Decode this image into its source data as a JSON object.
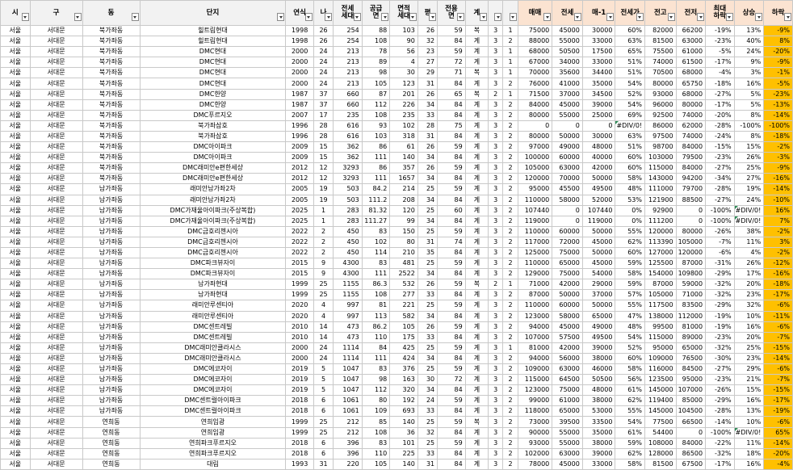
{
  "headers": [
    "시",
    "구",
    "동",
    "단지",
    "연식",
    "나",
    "전세\n세대",
    "공급\n면",
    "면적\n세대",
    "평",
    "전용\n면",
    "계",
    "",
    "",
    "매매",
    "전세",
    "매-1",
    "전세가",
    "전고",
    "전저",
    "최대\n하락",
    "상승",
    "하락"
  ],
  "rows": [
    [
      "서울",
      "서대문",
      "북가좌동",
      "힐트림현대",
      "1998",
      "26",
      "254",
      "88",
      "103",
      "26",
      "59",
      "복",
      "3",
      "1",
      "75000",
      "45000",
      "30000",
      "60%",
      "82000",
      "66200",
      "-19%",
      "13%",
      "-9%"
    ],
    [
      "서울",
      "서대문",
      "북가좌동",
      "힐트림현대",
      "1998",
      "26",
      "254",
      "108",
      "90",
      "32",
      "84",
      "계",
      "3",
      "2",
      "88000",
      "55000",
      "33000",
      "63%",
      "81500",
      "63000",
      "-23%",
      "40%",
      "8%"
    ],
    [
      "서울",
      "서대문",
      "북가좌동",
      "DMC현대",
      "2000",
      "24",
      "213",
      "78",
      "56",
      "23",
      "59",
      "계",
      "3",
      "1",
      "68000",
      "50500",
      "17500",
      "65%",
      "75500",
      "61000",
      "-5%",
      "24%",
      "-20%"
    ],
    [
      "서울",
      "서대문",
      "북가좌동",
      "DMC현대",
      "2000",
      "24",
      "213",
      "89",
      "4",
      "27",
      "72",
      "계",
      "3",
      "1",
      "67000",
      "34000",
      "33000",
      "51%",
      "74000",
      "61500",
      "-17%",
      "9%",
      "-9%"
    ],
    [
      "서울",
      "서대문",
      "북가좌동",
      "DMC현대",
      "2000",
      "24",
      "213",
      "98",
      "30",
      "29",
      "71",
      "복",
      "3",
      "1",
      "70000",
      "35600",
      "34400",
      "51%",
      "70500",
      "68000",
      "-4%",
      "3%",
      "-1%"
    ],
    [
      "서울",
      "서대문",
      "북가좌동",
      "DMC현대",
      "2000",
      "24",
      "213",
      "105",
      "123",
      "31",
      "84",
      "계",
      "3",
      "2",
      "76000",
      "41000",
      "35000",
      "54%",
      "80000",
      "65750",
      "-18%",
      "16%",
      "-5%"
    ],
    [
      "서울",
      "서대문",
      "북가좌동",
      "DMC한양",
      "1987",
      "37",
      "660",
      "87",
      "201",
      "26",
      "65",
      "복",
      "2",
      "1",
      "71500",
      "37000",
      "34500",
      "52%",
      "93000",
      "68000",
      "-27%",
      "5%",
      "-23%"
    ],
    [
      "서울",
      "서대문",
      "북가좌동",
      "DMC한양",
      "1987",
      "37",
      "660",
      "112",
      "226",
      "34",
      "84",
      "계",
      "3",
      "2",
      "84000",
      "45000",
      "39000",
      "54%",
      "96000",
      "80000",
      "-17%",
      "5%",
      "-13%"
    ],
    [
      "서울",
      "서대문",
      "북가좌동",
      "DMC푸르지오",
      "2007",
      "17",
      "235",
      "108",
      "235",
      "33",
      "84",
      "계",
      "3",
      "2",
      "80000",
      "55000",
      "25000",
      "69%",
      "92500",
      "74000",
      "-20%",
      "8%",
      "-14%"
    ],
    [
      "서울",
      "서대문",
      "북가좌동",
      "북가좌삼호",
      "1996",
      "28",
      "616",
      "93",
      "102",
      "28",
      "75",
      "계",
      "3",
      "2",
      "0",
      "0",
      "0",
      "#DIV/0!",
      "86000",
      "62000",
      "-28%",
      "-100%",
      "-100%"
    ],
    [
      "서울",
      "서대문",
      "북가좌동",
      "북가좌삼호",
      "1996",
      "28",
      "616",
      "103",
      "318",
      "31",
      "84",
      "계",
      "3",
      "2",
      "80000",
      "50000",
      "30000",
      "63%",
      "97500",
      "74000",
      "-24%",
      "8%",
      "-18%"
    ],
    [
      "서울",
      "서대문",
      "북가좌동",
      "DMC아이파크",
      "2009",
      "15",
      "362",
      "86",
      "61",
      "26",
      "59",
      "계",
      "3",
      "2",
      "97000",
      "49000",
      "48000",
      "51%",
      "98700",
      "84000",
      "-15%",
      "15%",
      "-2%"
    ],
    [
      "서울",
      "서대문",
      "북가좌동",
      "DMC아이파크",
      "2009",
      "15",
      "362",
      "111",
      "140",
      "34",
      "84",
      "계",
      "3",
      "2",
      "100000",
      "60000",
      "40000",
      "60%",
      "103000",
      "79500",
      "-23%",
      "26%",
      "-3%"
    ],
    [
      "서울",
      "서대문",
      "북가좌동",
      "DMC래미안e편한세상",
      "2012",
      "12",
      "3293",
      "86",
      "357",
      "26",
      "59",
      "계",
      "3",
      "2",
      "105000",
      "63000",
      "42000",
      "60%",
      "115000",
      "84000",
      "-27%",
      "25%",
      "-9%"
    ],
    [
      "서울",
      "서대문",
      "북가좌동",
      "DMC래미안e편한세상",
      "2012",
      "12",
      "3293",
      "111",
      "1657",
      "34",
      "84",
      "계",
      "3",
      "2",
      "120000",
      "70000",
      "50000",
      "58%",
      "143000",
      "94200",
      "-34%",
      "27%",
      "-16%"
    ],
    [
      "서울",
      "서대문",
      "남가좌동",
      "래미안남가좌2차",
      "2005",
      "19",
      "503",
      "84.2",
      "214",
      "25",
      "59",
      "계",
      "3",
      "2",
      "95000",
      "45500",
      "49500",
      "48%",
      "111000",
      "79700",
      "-28%",
      "19%",
      "-14%"
    ],
    [
      "서울",
      "서대문",
      "남가좌동",
      "래미안남가좌2차",
      "2005",
      "19",
      "503",
      "111.2",
      "208",
      "34",
      "84",
      "계",
      "3",
      "2",
      "110000",
      "58000",
      "52000",
      "53%",
      "121900",
      "88500",
      "-27%",
      "24%",
      "-10%"
    ],
    [
      "서울",
      "서대문",
      "남가좌동",
      "DMC가재울아이파크(주상복합)",
      "2025",
      "1",
      "283",
      "81.32",
      "120",
      "25",
      "60",
      "계",
      "3",
      "2",
      "107440",
      "0",
      "107440",
      "0%",
      "92900",
      "0",
      "-100%",
      "#DIV/0!",
      "16%"
    ],
    [
      "서울",
      "서대문",
      "남가좌동",
      "DMC가재울아이파크(주상복합)",
      "2025",
      "1",
      "283",
      "111.27",
      "99",
      "34",
      "84",
      "계",
      "3",
      "2",
      "119000",
      "0",
      "119000",
      "0%",
      "111200",
      "0",
      "-100%",
      "#DIV/0!",
      "7%"
    ],
    [
      "서울",
      "서대문",
      "남가좌동",
      "DMC금호리첸시아",
      "2022",
      "2",
      "450",
      "83",
      "150",
      "25",
      "59",
      "계",
      "3",
      "2",
      "110000",
      "60000",
      "50000",
      "55%",
      "120000",
      "80000",
      "-26%",
      "38%",
      "-2%"
    ],
    [
      "서울",
      "서대문",
      "남가좌동",
      "DMC금호리첸시아",
      "2022",
      "2",
      "450",
      "102",
      "80",
      "31",
      "74",
      "계",
      "3",
      "2",
      "117000",
      "72000",
      "45000",
      "62%",
      "113390",
      "105000",
      "-7%",
      "11%",
      "3%"
    ],
    [
      "서울",
      "서대문",
      "남가좌동",
      "DMC금호리첸시아",
      "2022",
      "2",
      "450",
      "114",
      "210",
      "35",
      "84",
      "계",
      "3",
      "2",
      "125000",
      "75000",
      "50000",
      "60%",
      "127000",
      "120000",
      "-6%",
      "4%",
      "-2%"
    ],
    [
      "서울",
      "서대문",
      "남가좌동",
      "DMC파크뷰자이",
      "2015",
      "9",
      "4300",
      "83",
      "481",
      "25",
      "59",
      "계",
      "3",
      "2",
      "110000",
      "65000",
      "45000",
      "59%",
      "125500",
      "87000",
      "-31%",
      "26%",
      "-12%"
    ],
    [
      "서울",
      "서대문",
      "남가좌동",
      "DMC파크뷰자이",
      "2015",
      "9",
      "4300",
      "111",
      "2522",
      "34",
      "84",
      "계",
      "3",
      "2",
      "129000",
      "75000",
      "54000",
      "58%",
      "154000",
      "109800",
      "-29%",
      "17%",
      "-16%"
    ],
    [
      "서울",
      "서대문",
      "남가좌동",
      "남가좌현대",
      "1999",
      "25",
      "1155",
      "86.3",
      "532",
      "26",
      "59",
      "복",
      "2",
      "1",
      "71000",
      "42000",
      "29000",
      "59%",
      "87000",
      "59000",
      "-32%",
      "20%",
      "-18%"
    ],
    [
      "서울",
      "서대문",
      "남가좌동",
      "남가좌현대",
      "1999",
      "25",
      "1155",
      "108",
      "277",
      "33",
      "84",
      "계",
      "3",
      "2",
      "87000",
      "50000",
      "37000",
      "57%",
      "105000",
      "71000",
      "-32%",
      "23%",
      "-17%"
    ],
    [
      "서울",
      "서대문",
      "남가좌동",
      "래미안루센티아",
      "2020",
      "4",
      "997",
      "81",
      "221",
      "25",
      "59",
      "계",
      "3",
      "2",
      "110000",
      "60000",
      "50000",
      "55%",
      "117500",
      "83500",
      "-29%",
      "32%",
      "-6%"
    ],
    [
      "서울",
      "서대문",
      "남가좌동",
      "래미안루센티아",
      "2020",
      "4",
      "997",
      "113",
      "582",
      "34",
      "84",
      "계",
      "3",
      "2",
      "123000",
      "58000",
      "65000",
      "47%",
      "138000",
      "112000",
      "-19%",
      "10%",
      "-11%"
    ],
    [
      "서울",
      "서대문",
      "남가좌동",
      "DMC센트레빌",
      "2010",
      "14",
      "473",
      "86.2",
      "105",
      "26",
      "59",
      "계",
      "3",
      "2",
      "94000",
      "45000",
      "49000",
      "48%",
      "99500",
      "81000",
      "-19%",
      "16%",
      "-6%"
    ],
    [
      "서울",
      "서대문",
      "남가좌동",
      "DMC센트레빌",
      "2010",
      "14",
      "473",
      "110",
      "175",
      "33",
      "84",
      "계",
      "3",
      "2",
      "107000",
      "57500",
      "49500",
      "54%",
      "115000",
      "89000",
      "-23%",
      "20%",
      "-7%"
    ],
    [
      "서울",
      "서대문",
      "남가좌동",
      "DMC래미안클라시스",
      "2000",
      "24",
      "1114",
      "84",
      "425",
      "25",
      "59",
      "계",
      "3",
      "1",
      "81000",
      "42000",
      "39000",
      "52%",
      "95000",
      "65000",
      "-32%",
      "25%",
      "-15%"
    ],
    [
      "서울",
      "서대문",
      "남가좌동",
      "DMC래미안클라시스",
      "2000",
      "24",
      "1114",
      "111",
      "424",
      "34",
      "84",
      "계",
      "3",
      "2",
      "94000",
      "56000",
      "38000",
      "60%",
      "109000",
      "76500",
      "-30%",
      "23%",
      "-14%"
    ],
    [
      "서울",
      "서대문",
      "남가좌동",
      "DMC에코자이",
      "2019",
      "5",
      "1047",
      "83",
      "376",
      "25",
      "59",
      "계",
      "3",
      "2",
      "109000",
      "63000",
      "46000",
      "58%",
      "116000",
      "84500",
      "-27%",
      "29%",
      "-6%"
    ],
    [
      "서울",
      "서대문",
      "남가좌동",
      "DMC에코자이",
      "2019",
      "5",
      "1047",
      "98",
      "163",
      "30",
      "72",
      "계",
      "3",
      "2",
      "115000",
      "64500",
      "50500",
      "56%",
      "123500",
      "95000",
      "-23%",
      "21%",
      "-7%"
    ],
    [
      "서울",
      "서대문",
      "남가좌동",
      "DMC에코자이",
      "2019",
      "5",
      "1047",
      "112",
      "320",
      "34",
      "84",
      "계",
      "3",
      "2",
      "123000",
      "75000",
      "48000",
      "61%",
      "145000",
      "107000",
      "-26%",
      "15%",
      "-15%"
    ],
    [
      "서울",
      "서대문",
      "남가좌동",
      "DMC센트럴아이파크",
      "2018",
      "6",
      "1061",
      "80",
      "192",
      "24",
      "59",
      "계",
      "3",
      "2",
      "99000",
      "61000",
      "38000",
      "62%",
      "119400",
      "85000",
      "-29%",
      "16%",
      "-17%"
    ],
    [
      "서울",
      "서대문",
      "남가좌동",
      "DMC센트럴아이파크",
      "2018",
      "6",
      "1061",
      "109",
      "693",
      "33",
      "84",
      "계",
      "3",
      "2",
      "118000",
      "65000",
      "53000",
      "55%",
      "145000",
      "104500",
      "-28%",
      "13%",
      "-19%"
    ],
    [
      "서울",
      "서대문",
      "연희동",
      "연희임광",
      "1999",
      "25",
      "212",
      "85",
      "140",
      "25",
      "59",
      "복",
      "3",
      "2",
      "73000",
      "39500",
      "33500",
      "54%",
      "77500",
      "66500",
      "-14%",
      "10%",
      "-6%"
    ],
    [
      "서울",
      "서대문",
      "연희동",
      "연희임광",
      "1999",
      "25",
      "212",
      "108",
      "36",
      "32",
      "84",
      "계",
      "3",
      "2",
      "90000",
      "55000",
      "35000",
      "61%",
      "54400",
      "0",
      "-100%",
      "#DIV/0!",
      "65%"
    ],
    [
      "서울",
      "서대문",
      "연희동",
      "연희파크푸르지오",
      "2018",
      "6",
      "396",
      "83",
      "101",
      "25",
      "59",
      "계",
      "3",
      "2",
      "93000",
      "55000",
      "38000",
      "59%",
      "108000",
      "84000",
      "-22%",
      "11%",
      "-14%"
    ],
    [
      "서울",
      "서대문",
      "연희동",
      "연희파크푸르지오",
      "2018",
      "6",
      "396",
      "110",
      "225",
      "33",
      "84",
      "계",
      "3",
      "2",
      "102000",
      "63000",
      "39000",
      "62%",
      "128000",
      "86500",
      "-32%",
      "18%",
      "-20%"
    ],
    [
      "서울",
      "서대문",
      "연희동",
      "대림",
      "1993",
      "31",
      "220",
      "105",
      "140",
      "31",
      "84",
      "계",
      "3",
      "2",
      "78000",
      "45000",
      "33000",
      "58%",
      "81500",
      "67500",
      "-17%",
      "16%",
      "-4%"
    ]
  ]
}
